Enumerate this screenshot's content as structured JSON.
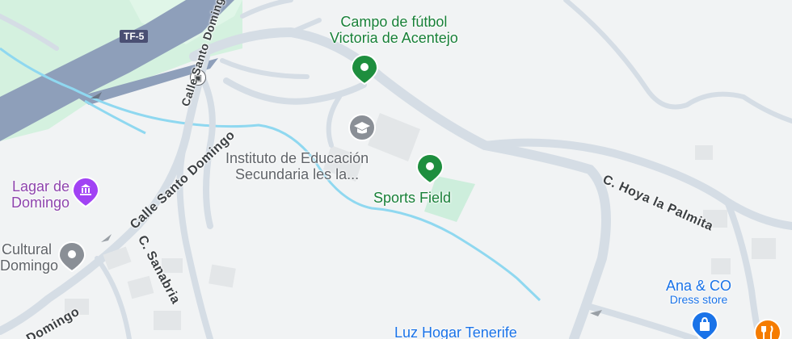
{
  "map": {
    "highway_shield": "TF-5",
    "pois": {
      "campo": {
        "line1": "Campo de fútbol",
        "line2": "Victoria de Acentejo",
        "icon": "green-pin-icon"
      },
      "instituto": {
        "line1": "Instituto de Educación",
        "line2": "Secundaria les la...",
        "icon": "school-icon"
      },
      "sports_field": {
        "label": "Sports Field",
        "icon": "green-pin-icon"
      },
      "lagar": {
        "line1": "Lagar de",
        "line2": "Domingo",
        "icon": "museum-icon"
      },
      "cultural": {
        "line1": "Cultural",
        "line2": "Domingo",
        "icon": "gray-pin-icon"
      },
      "ana_co": {
        "label": "Ana & CO",
        "sub": "Dress store",
        "icon": "shopping-bag-icon"
      },
      "luz_hogar": {
        "label": "Luz Hogar Tenerife"
      },
      "restaurant": {
        "icon": "restaurant-icon"
      }
    },
    "streets": {
      "hoya": "C. Hoya la Palmita",
      "santo_domingo": "Calle Santo Domingo",
      "sanabria": "C. Sanabria",
      "domingo_bottom": "Domingo",
      "santo_domingo_vertical": "Calle Santo Domingo"
    },
    "colors": {
      "background": "#f1f3f4",
      "park": "#d4f1df",
      "highway": "#8e9fba",
      "road": "#d5dde5",
      "water": "#8fd8f0",
      "green_marker": "#1e8e3e",
      "blue_marker": "#1a73e8",
      "orange_marker": "#f57c00",
      "purple_marker": "#a142f4"
    }
  }
}
